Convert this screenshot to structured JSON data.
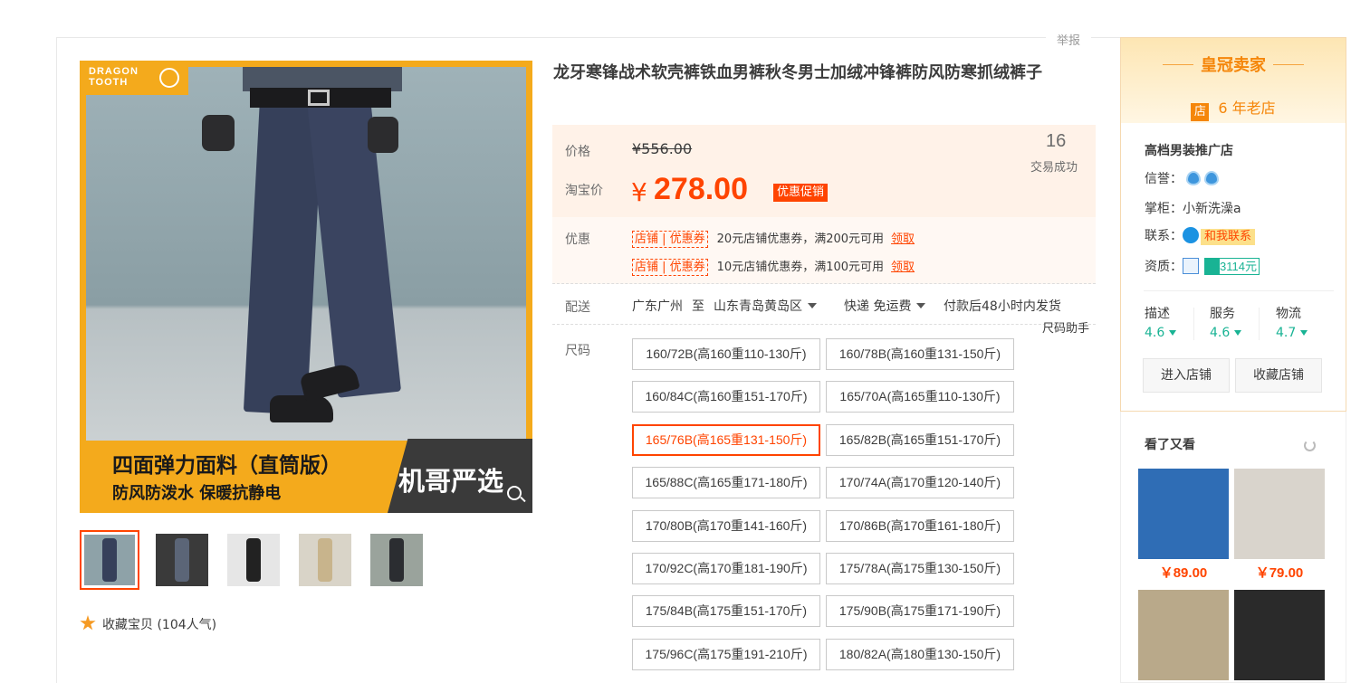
{
  "page": {
    "report_link": "举报"
  },
  "gallery": {
    "logo_text": "DRAGON TOOTH",
    "banner_line1": "四面弹力面料（直筒版）",
    "banner_line2": "防风防泼水 保暖抗静电",
    "banner_badge": "机哥严选",
    "zoom_icon": "zoom-icon",
    "thumbnails": [
      "thumb-1",
      "thumb-2",
      "thumb-3",
      "thumb-4",
      "thumb-5"
    ],
    "collect_label": "收藏宝贝",
    "collect_count": "(104人气)"
  },
  "product": {
    "title": "龙牙寒锋战术软壳裤铁血男裤秋冬男士加绒冲锋裤防风防寒抓绒裤子"
  },
  "price": {
    "label_price": "价格",
    "original": "¥556.00",
    "label_tb": "淘宝价",
    "currency": "¥",
    "current": "278.00",
    "promo_tag": "优惠促销",
    "sold_count": "16",
    "sold_label": "交易成功"
  },
  "coupons": {
    "label": "优惠",
    "items": [
      {
        "tag": "店铺 | 优惠券",
        "text": "20元店铺优惠券，满200元可用",
        "action": "领取"
      },
      {
        "tag": "店铺 | 优惠券",
        "text": "10元店铺优惠券，满100元可用",
        "action": "领取"
      }
    ]
  },
  "shipping": {
    "label": "配送",
    "from": "广东广州",
    "to_word": "至",
    "to": "山东青岛黄岛区",
    "method": "快递 免运费",
    "promise": "付款后48小时内发货",
    "size_helper": "尺码助手"
  },
  "sizes": {
    "label": "尺码",
    "selected_index": 4,
    "options": [
      "160/72B(高160重110-130斤)",
      "160/78B(高160重131-150斤)",
      "160/84C(高160重151-170斤)",
      "165/70A(高165重110-130斤)",
      "165/76B(高165重131-150斤)",
      "165/82B(高165重151-170斤)",
      "165/88C(高165重171-180斤)",
      "170/74A(高170重120-140斤)",
      "170/80B(高170重141-160斤)",
      "170/86B(高170重161-180斤)",
      "170/92C(高170重181-190斤)",
      "175/78A(高175重130-150斤)",
      "175/84B(高175重151-170斤)",
      "175/90B(高175重171-190斤)",
      "175/96C(高175重191-210斤)",
      "180/82A(高180重130-150斤)"
    ]
  },
  "shop": {
    "level_title": "皇冠卖家",
    "age_icon": "店",
    "age_text": "6 年老店",
    "name": "高档男装推广店",
    "credit_label": "信誉：",
    "keeper_label": "掌柜：",
    "keeper": "小新洗澡a",
    "contact_label": "联系：",
    "contact_button": "和我联系",
    "cert_label": "资质：",
    "cert_count": "3114元",
    "scores": [
      {
        "name": "描述",
        "value": "4.6"
      },
      {
        "name": "服务",
        "value": "4.6"
      },
      {
        "name": "物流",
        "value": "4.7"
      }
    ],
    "enter_button": "进入店铺",
    "fav_button": "收藏店铺"
  },
  "also_viewed": {
    "title": "看了又看",
    "items": [
      {
        "price": "￥89.00",
        "color": "#2f6db5"
      },
      {
        "price": "￥79.00",
        "color": "#d9d4cc"
      },
      {
        "price": "",
        "color": "#b9a98a"
      },
      {
        "price": "",
        "color": "#2a2a2a"
      }
    ]
  },
  "colors": {
    "accent": "#ff4400",
    "teal": "#19b394",
    "gold": "#f4aa1c"
  }
}
